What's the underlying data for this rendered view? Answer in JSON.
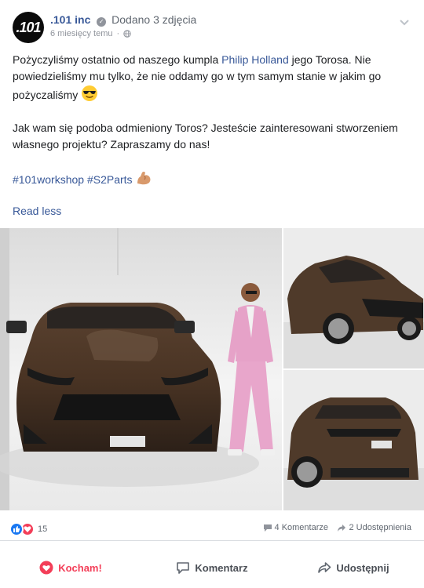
{
  "post": {
    "author": ".101 inc",
    "avatar_text": ".101",
    "action": "Dodano 3 zdjęcia",
    "time": "6 miesięcy temu",
    "text": {
      "p1_before": "Pożyczyliśmy ostatnio od naszego kumpla ",
      "p1_link": "Philip Holland",
      "p1_after": " jego Torosa. Nie powiedzieliśmy mu tylko, że nie oddamy go w tym samym stanie w jakim go pożyczaliśmy",
      "p2": "Jak wam się podoba odmieniony Toros? Jesteście zainteresowani stworzeniem własnego projektu? Zapraszamy do nas!",
      "hashtag1": "#101workshop",
      "hashtag2": "#S2Parts"
    },
    "read_less": "Read less"
  },
  "stats": {
    "reaction_count": "15",
    "comments": "4 Komentarze",
    "shares": "2 Udostępnienia"
  },
  "actions": {
    "love": "Kocham!",
    "comment": "Komentarz",
    "share": "Udostępnij"
  },
  "colors": {
    "link": "#385898",
    "love": "#f33e58",
    "like": "#1877f2"
  }
}
